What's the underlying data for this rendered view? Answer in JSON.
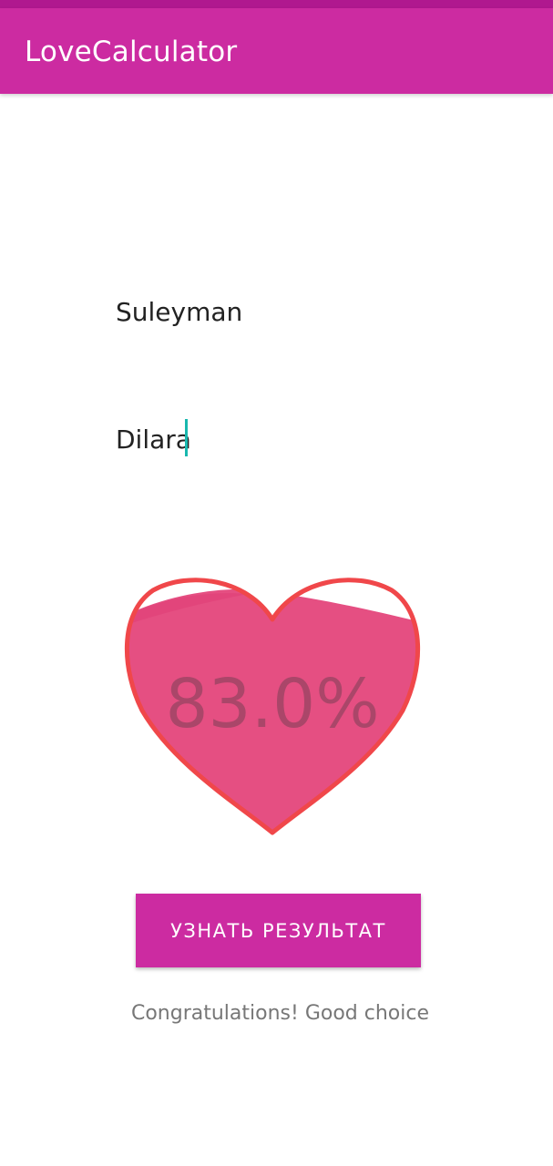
{
  "app_bar": {
    "title": "LoveCalculator"
  },
  "form": {
    "first_name": "Suleyman",
    "second_name": "Dilara"
  },
  "result": {
    "percent_label": "83.0%",
    "percent_value": 83.0,
    "button_label": "УЗНАТЬ РЕЗУЛЬТАТ",
    "message": "Congratulations! Good choice"
  },
  "colors": {
    "app_bar": "#cc2ba1",
    "status_bar": "#b0188f",
    "heart_outline": "#f0474a",
    "heart_fill": "#e54f82",
    "cursor": "#18b8ae"
  }
}
